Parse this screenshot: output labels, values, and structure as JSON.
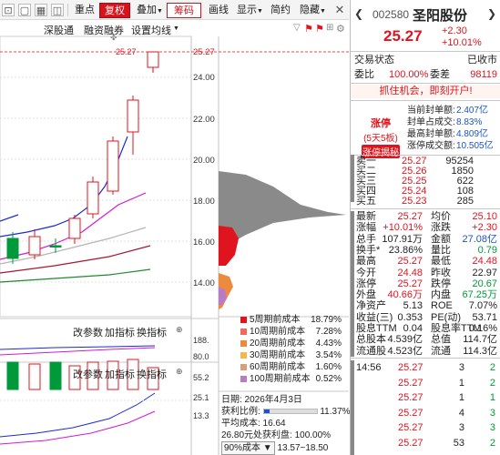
{
  "toolbar": {
    "items": [
      "重点",
      "复权",
      "叠加",
      "筹码",
      "画线",
      "显示",
      "简约",
      "隐藏"
    ],
    "chevrons": [
      "▼",
      "▼",
      "▼",
      "▼"
    ]
  },
  "subtabs": [
    "深股通",
    "融资融券",
    "设置均线"
  ],
  "price_axis": {
    "labels": [
      "25.27",
      "24.00",
      "22.00",
      "20.00",
      "18.00",
      "16.00",
      "14.00"
    ],
    "limit_line_label": "25.27"
  },
  "indicators": {
    "row1": [
      "改参数",
      "加指标",
      "换指标"
    ],
    "row2": [
      "改参数",
      "加指标",
      "换指标"
    ],
    "vol_axis": [
      "188.",
      "80.0",
      "55.2",
      "25.1",
      "13.3"
    ]
  },
  "profile": {
    "rows": [
      {
        "name": "5周期前成本",
        "pct": "18.79%",
        "color": "#e0141e"
      },
      {
        "name": "10周期前成本",
        "pct": "7.28%",
        "color": "#ef6a5a"
      },
      {
        "name": "20周期前成本",
        "pct": "4.43%",
        "color": "#ee8a3c"
      },
      {
        "name": "30周期前成本",
        "pct": "3.54%",
        "color": "#f5b64a"
      },
      {
        "name": "60周期前成本",
        "pct": "1.60%",
        "color": "#d6a07a"
      },
      {
        "name": "100周期前成本",
        "pct": "0.52%",
        "color": "#b97cc4"
      }
    ],
    "date_label": "日期: 2026年4月3日",
    "profit_label": "获利比例:",
    "profit_value": "11.37%",
    "avg_cost": "平均成本: 16.64",
    "profit_line": "26.80元处获利盘: 100.00%",
    "cost_range_select": "90%成本",
    "cost_range": "13.57~18.50"
  },
  "quote": {
    "code": "002580",
    "name": "圣阳股份",
    "price": "25.27",
    "change": "+2.30",
    "change_pct": "+10.01%",
    "status_label": "交易状态",
    "status_value": "已收市",
    "ratio_label": "委比",
    "ratio_value": "100.00%",
    "diff_label": "委差",
    "diff_value": "98119",
    "promo": "抓住机会，即刻开户!",
    "limit_badge": {
      "title": "涨停",
      "sub": "(5天5板)",
      "btn": "涨停揭秘"
    },
    "limit_stats": [
      {
        "label": "当前封单额:",
        "value": "2.407亿"
      },
      {
        "label": "封单占成交:",
        "value": "8.83%"
      },
      {
        "label": "最高封单额:",
        "value": "4.809亿"
      },
      {
        "label": "涨停成交额:",
        "value": "10.505亿"
      }
    ],
    "orderbook": [
      {
        "label": "卖一",
        "price": "25.27",
        "vol": "95254"
      },
      {
        "label": "买二",
        "price": "25.26",
        "vol": "1850"
      },
      {
        "label": "买三",
        "price": "25.25",
        "vol": "622"
      },
      {
        "label": "买四",
        "price": "25.24",
        "vol": "108"
      },
      {
        "label": "买五",
        "price": "25.23",
        "vol": "285"
      }
    ],
    "stats": [
      {
        "l1": "最新",
        "v1": "25.27",
        "c1": "red",
        "l2": "均价",
        "v2": "25.10",
        "c2": "red"
      },
      {
        "l1": "涨幅",
        "v1": "+10.01%",
        "c1": "red",
        "l2": "涨跌",
        "v2": "+2.30",
        "c2": "red"
      },
      {
        "l1": "总手",
        "v1": "107.91万",
        "c1": "dark",
        "l2": "金额",
        "v2": "27.08亿",
        "c2": "blue"
      },
      {
        "l1": "换手*",
        "v1": "23.86%",
        "c1": "dark",
        "l2": "量比",
        "v2": "0.79",
        "c2": "green"
      },
      {
        "l1": "最高",
        "v1": "25.27",
        "c1": "red",
        "l2": "最低",
        "v2": "24.48",
        "c2": "red"
      },
      {
        "l1": "今开",
        "v1": "24.48",
        "c1": "red",
        "l2": "昨收",
        "v2": "22.97",
        "c2": "dark"
      },
      {
        "l1": "涨停",
        "v1": "25.27",
        "c1": "red",
        "l2": "跌停",
        "v2": "20.67",
        "c2": "green"
      },
      {
        "l1": "外盘",
        "v1": "40.66万",
        "c1": "red",
        "l2": "内盘",
        "v2": "67.25万",
        "c2": "green"
      },
      {
        "l1": "净资产",
        "v1": "5.13",
        "c1": "dark",
        "l2": "ROE",
        "v2": "7.07%",
        "c2": "dark"
      },
      {
        "l1": "收益(三)",
        "v1": "0.353",
        "c1": "dark",
        "l2": "PE(动)",
        "v2": "53.71",
        "c2": "dark"
      },
      {
        "l1": "股息TTM",
        "v1": "0.04",
        "c1": "dark",
        "l2": "股息率TTM",
        "v2": "0.16%",
        "c2": "dark"
      },
      {
        "l1": "总股本",
        "v1": "4.539亿",
        "c1": "dark",
        "l2": "总值",
        "v2": "114.7亿",
        "c2": "dark"
      },
      {
        "l1": "流通股",
        "v1": "4.523亿",
        "c1": "dark",
        "l2": "流通",
        "v2": "114.3亿",
        "c2": "dark"
      }
    ],
    "ticks": [
      {
        "time": "14:56",
        "price": "25.27",
        "vol": "3",
        "dir": "2",
        "dircolor": "green"
      },
      {
        "time": "",
        "price": "25.27",
        "vol": "1",
        "dir": "2",
        "dircolor": "green"
      },
      {
        "time": "",
        "price": "25.27",
        "vol": "1",
        "dir": "1",
        "dircolor": "green"
      },
      {
        "time": "",
        "price": "25.27",
        "vol": "4",
        "dir": "3",
        "dircolor": "green"
      },
      {
        "time": "",
        "price": "25.27",
        "vol": "3",
        "dir": "3",
        "dircolor": "green"
      },
      {
        "time": "",
        "price": "25.27",
        "vol": "53",
        "dir": "2",
        "dircolor": "green"
      }
    ]
  },
  "colors": {
    "up": "#e0141e",
    "down": "#009a3a",
    "ma5": "#1c2bd0",
    "ma10": "#d21bd2",
    "ma20": "#b5b5b5",
    "ma30": "#a6192e",
    "ma60": "#1f8a2c"
  }
}
